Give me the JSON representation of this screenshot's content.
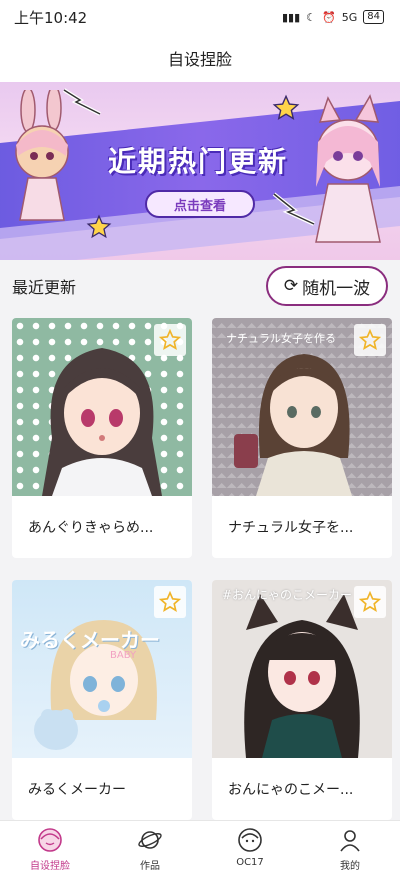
{
  "status_bar": {
    "time": "上午10:42",
    "battery": "84",
    "signal": "5G"
  },
  "header": {
    "title": "自设捏脸"
  },
  "banner": {
    "title": "近期热门更新",
    "button": "点击查看"
  },
  "section": {
    "title": "最近更新",
    "random_button": "随机一波"
  },
  "cards": [
    {
      "caption": "あんぐりきゃらめ..."
    },
    {
      "caption": "ナチュラル女子を..."
    },
    {
      "caption": "みるくメーカー"
    },
    {
      "caption": "おんにゃのこメー..."
    }
  ],
  "card_overlays": {
    "c2_top": "ナチュラル女子を作る",
    "c3_top": "みるくメーカー",
    "c3_sub": "BABY",
    "c4_top": "#おんにゃのこメーカー"
  },
  "nav": [
    {
      "label": "自设捏脸",
      "icon": "face-icon",
      "active": true
    },
    {
      "label": "作品",
      "icon": "planet-icon",
      "active": false
    },
    {
      "label": "OC17",
      "icon": "avatar-icon",
      "active": false
    },
    {
      "label": "我的",
      "icon": "user-icon",
      "active": false
    }
  ],
  "colors": {
    "accent": "#c2398a",
    "banner_band": "#7b63e6",
    "button_border": "#8a2d7e"
  }
}
